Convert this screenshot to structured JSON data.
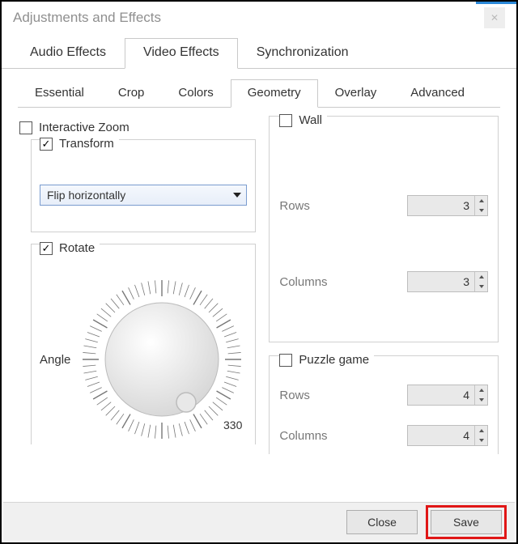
{
  "window": {
    "title": "Adjustments and Effects"
  },
  "tabs_l1": {
    "audio": "Audio Effects",
    "video": "Video Effects",
    "sync": "Synchronization",
    "active": 1
  },
  "tabs_l2": {
    "essential": "Essential",
    "crop": "Crop",
    "colors": "Colors",
    "geometry": "Geometry",
    "overlay": "Overlay",
    "advanced": "Advanced",
    "active": 3
  },
  "left": {
    "interactive_zoom": {
      "label": "Interactive Zoom",
      "checked": false
    },
    "transform": {
      "label": "Transform",
      "checked": true,
      "mode": "Flip horizontally"
    },
    "rotate": {
      "label": "Rotate",
      "checked": true,
      "angle_label": "Angle",
      "tick_label": "330"
    }
  },
  "right": {
    "wall": {
      "label": "Wall",
      "checked": false,
      "rows": {
        "label": "Rows",
        "value": "3"
      },
      "columns": {
        "label": "Columns",
        "value": "3"
      }
    },
    "puzzle": {
      "label": "Puzzle game",
      "checked": false,
      "rows": {
        "label": "Rows",
        "value": "4"
      },
      "columns": {
        "label": "Columns",
        "value": "4"
      }
    }
  },
  "footer": {
    "close": "Close",
    "save": "Save"
  }
}
